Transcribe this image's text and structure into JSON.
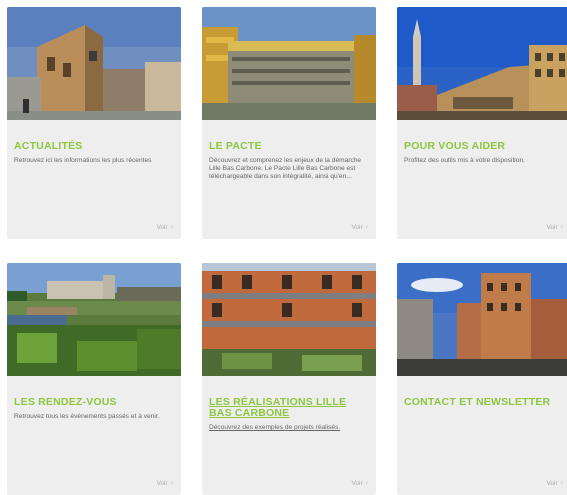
{
  "cards": [
    {
      "title": "ACTUALITÉS",
      "desc": "Retrouvez ici les informations les plus récentes",
      "more": "Voir",
      "arrow": "›"
    },
    {
      "title": "LE PACTE",
      "desc": "Découvrez et comprenez les enjeux de la démarche Lille Bas Carbone. Le Pacte Lille Bas Carbone est téléchargeable dans son intégralité, ainsi qu'en...",
      "more": "Voir",
      "arrow": "›"
    },
    {
      "title": "POUR VOUS AIDER",
      "desc": "Profitez des outils mis à votre disposition.",
      "more": "Voir",
      "arrow": "›"
    },
    {
      "title": "LES RENDEZ-VOUS",
      "desc": "Retrouvez tous les événements passés et à venir.",
      "more": "Voir",
      "arrow": "›"
    },
    {
      "title": "LES RÉALISATIONS LILLE BAS CARBONE",
      "desc": "Découvrez des exemples de projets réalisés.",
      "more": "Voir",
      "arrow": "›"
    },
    {
      "title": "CONTACT ET NEWSLETTER",
      "desc": "",
      "more": "Voir",
      "arrow": "›"
    }
  ]
}
